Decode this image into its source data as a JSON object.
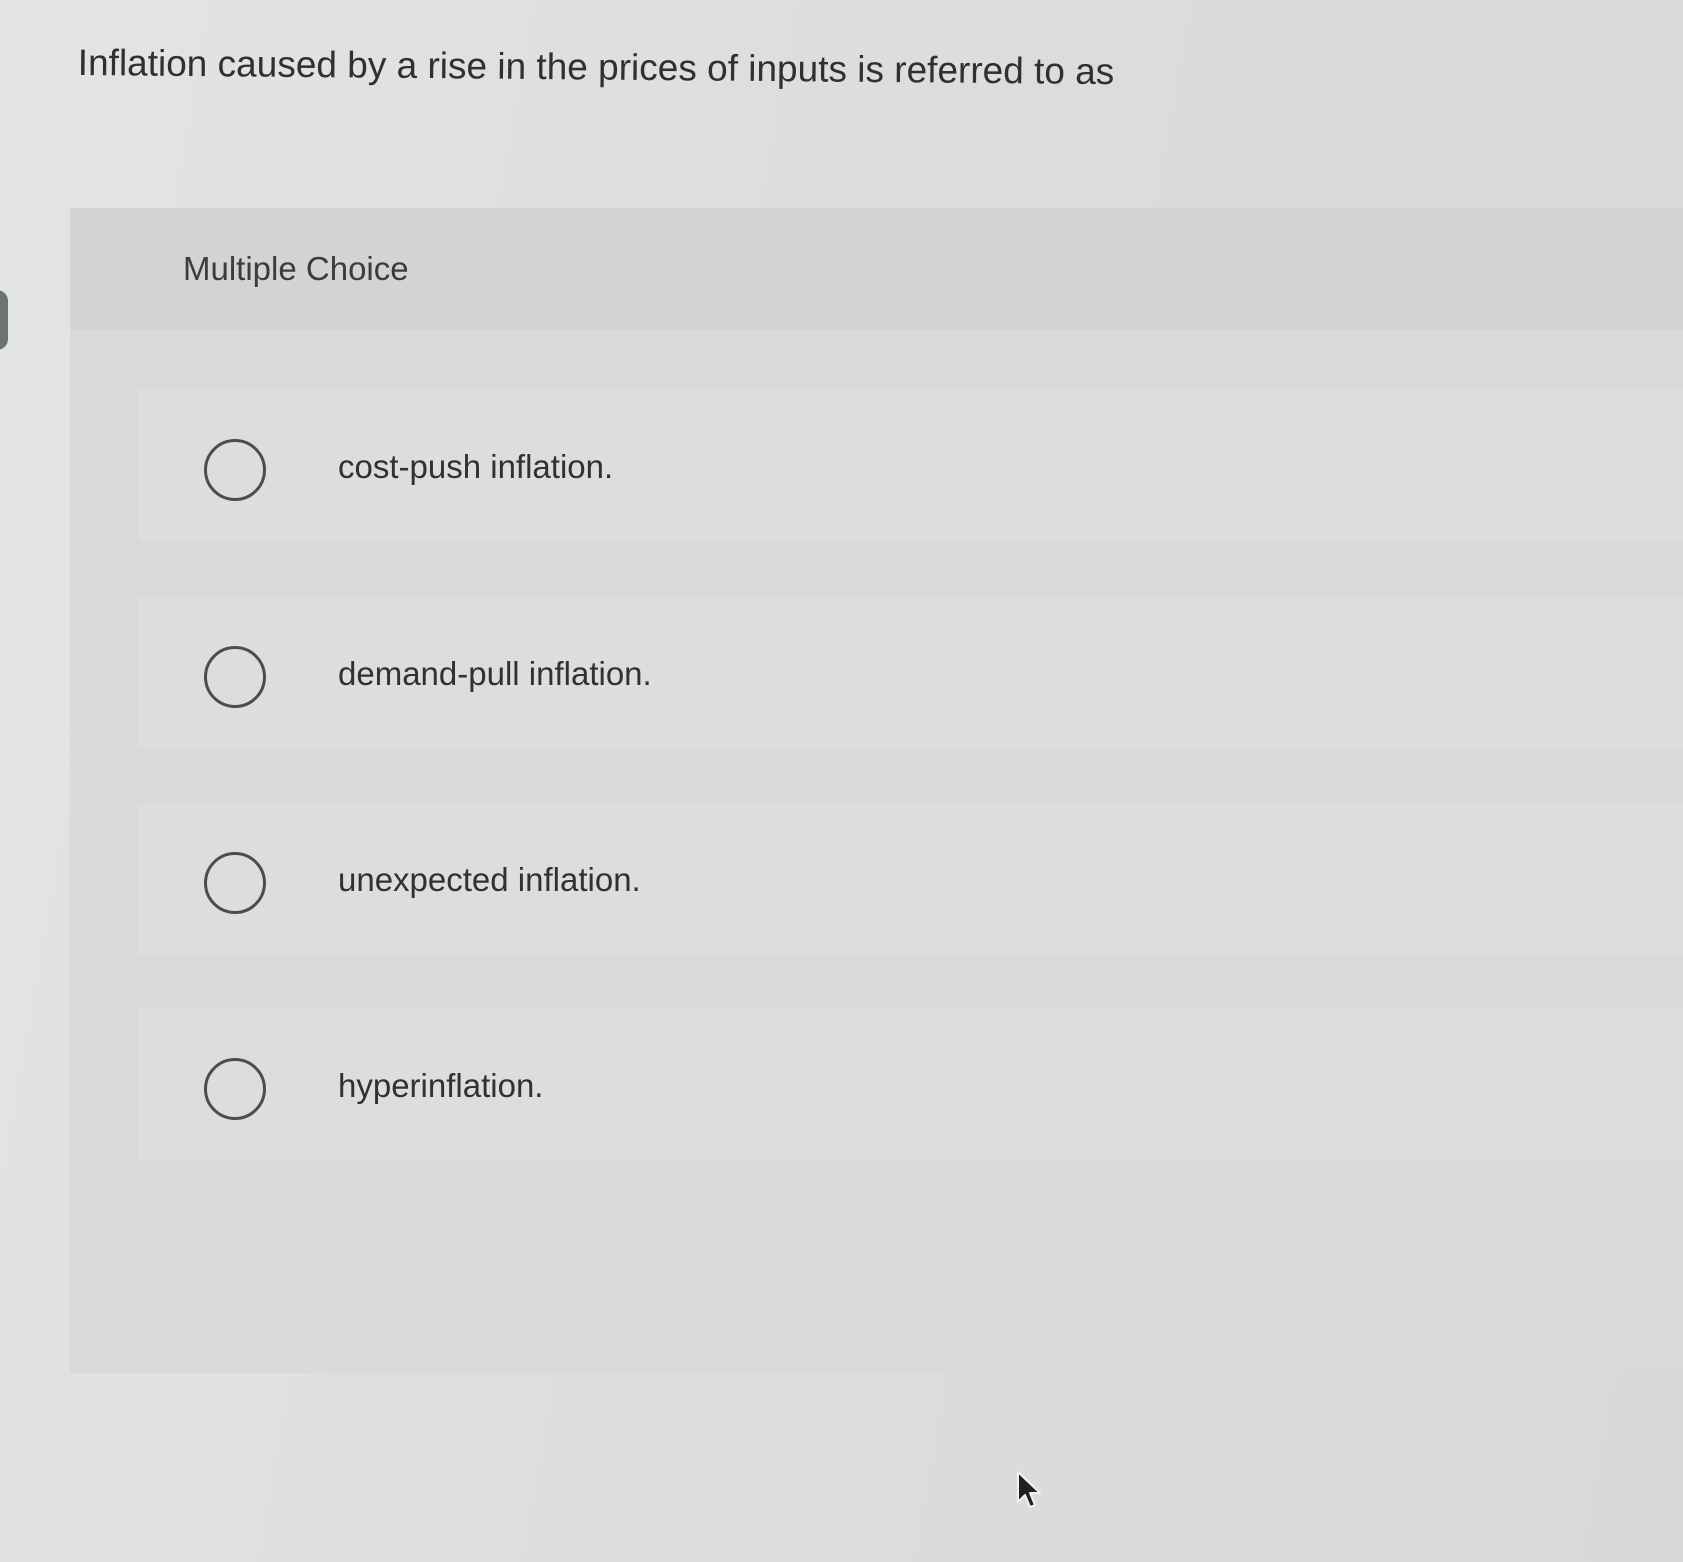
{
  "question": {
    "text": "Inflation caused by a rise in the prices of inputs is referred to as"
  },
  "card": {
    "header_label": "Multiple Choice"
  },
  "options": [
    {
      "label": "cost-push inflation.",
      "selected": false
    },
    {
      "label": "demand-pull inflation.",
      "selected": false
    },
    {
      "label": "unexpected inflation.",
      "selected": false
    },
    {
      "label": "hyperinflation.",
      "selected": false
    }
  ],
  "icons": {
    "radio": "radio-unchecked-icon",
    "cursor": "mouse-pointer-icon"
  },
  "colors": {
    "background": "#dfe1df",
    "card": "#d8dad9",
    "text": "#2b2d2e"
  }
}
